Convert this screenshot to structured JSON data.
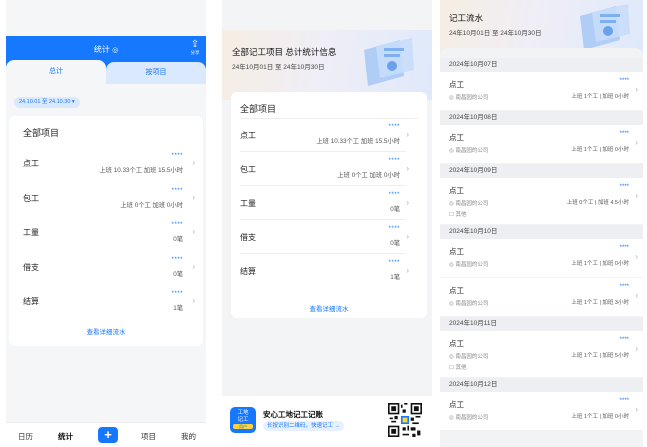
{
  "panel1": {
    "title": "统计",
    "share_label": "分享",
    "tabs": [
      "总计",
      "按项目"
    ],
    "date_range": "24.10.01 至 24.10.30",
    "card_title": "全部项目",
    "rows": [
      {
        "label": "点工",
        "dots": "****",
        "detail": "上班 10.33个工 加班 15.5小时"
      },
      {
        "label": "包工",
        "dots": "****",
        "detail": "上班 0个工 加班 0小时"
      },
      {
        "label": "工量",
        "dots": "****",
        "detail": "0笔"
      },
      {
        "label": "借支",
        "dots": "****",
        "detail": "0笔"
      },
      {
        "label": "结算",
        "dots": "****",
        "detail": "1笔"
      }
    ],
    "link": "查看详细流水",
    "nav": [
      "日历",
      "统计",
      "+",
      "项目",
      "我的"
    ]
  },
  "panel2": {
    "title": "全部记工项目 总计统计信息",
    "subtitle": "24年10月01日 至 24年10月30日",
    "card_title": "全部项目",
    "rows": [
      {
        "label": "点工",
        "dots": "****",
        "detail": "上班 10.33个工 加班 15.5小时"
      },
      {
        "label": "包工",
        "dots": "****",
        "detail": "上班 0个工 加班 0小时"
      },
      {
        "label": "工量",
        "dots": "****",
        "detail": "0笔"
      },
      {
        "label": "借支",
        "dots": "****",
        "detail": "0笔"
      },
      {
        "label": "结算",
        "dots": "****",
        "detail": "1笔"
      }
    ],
    "link": "查看详细流水",
    "ad": {
      "logo_line1": "工地",
      "logo_line2": "记工",
      "logo_badge": "用户",
      "title": "安心工地记工记账",
      "subtitle": "长按识别二维码，快速记工 →"
    }
  },
  "panel3": {
    "title": "记工流水",
    "subtitle": "24年10月01日 至 24年10月30日",
    "groups": [
      {
        "date": "2024年10月07日",
        "entries": [
          {
            "type": "点工",
            "company": "◎ 南昌园的公司",
            "dots": "****",
            "detail": "上班 1个工 | 加班 0小时",
            "other": ""
          }
        ]
      },
      {
        "date": "2024年10月08日",
        "entries": [
          {
            "type": "点工",
            "company": "◎ 南昌园的公司",
            "dots": "****",
            "detail": "上班 1个工 | 加班 0小时",
            "other": ""
          }
        ]
      },
      {
        "date": "2024年10月09日",
        "entries": [
          {
            "type": "点工",
            "company": "◎ 南昌园的公司",
            "dots": "****",
            "detail": "上班 0个工 | 加班 4.5小时",
            "other": "☐ 其他"
          }
        ]
      },
      {
        "date": "2024年10月10日",
        "entries": [
          {
            "type": "点工",
            "company": "◎ 南昌园的公司",
            "dots": "****",
            "detail": "上班 1个工 | 加班 0小时",
            "other": ""
          },
          {
            "type": "点工",
            "company": "◎ 南昌园的公司",
            "dots": "****",
            "detail": "上班 1个工 | 加班 3小时",
            "other": ""
          }
        ]
      },
      {
        "date": "2024年10月11日",
        "entries": [
          {
            "type": "点工",
            "company": "◎ 南昌园的公司",
            "dots": "****",
            "detail": "上班 1个工 | 加班 5小时",
            "other": "☐ 其他"
          }
        ]
      },
      {
        "date": "2024年10月12日",
        "entries": [
          {
            "type": "点工",
            "company": "◎ 南昌园的公司",
            "dots": "****",
            "detail": "上班 1个工 | 加班 0小时",
            "other": ""
          }
        ]
      }
    ]
  },
  "colors": {
    "accent": "#1677ff",
    "bg": "#f5f6f8"
  },
  "icons": {
    "share": "share-icon",
    "chevron": "chevron-right-icon",
    "plus": "plus-icon",
    "qr": "qr-code-icon"
  }
}
